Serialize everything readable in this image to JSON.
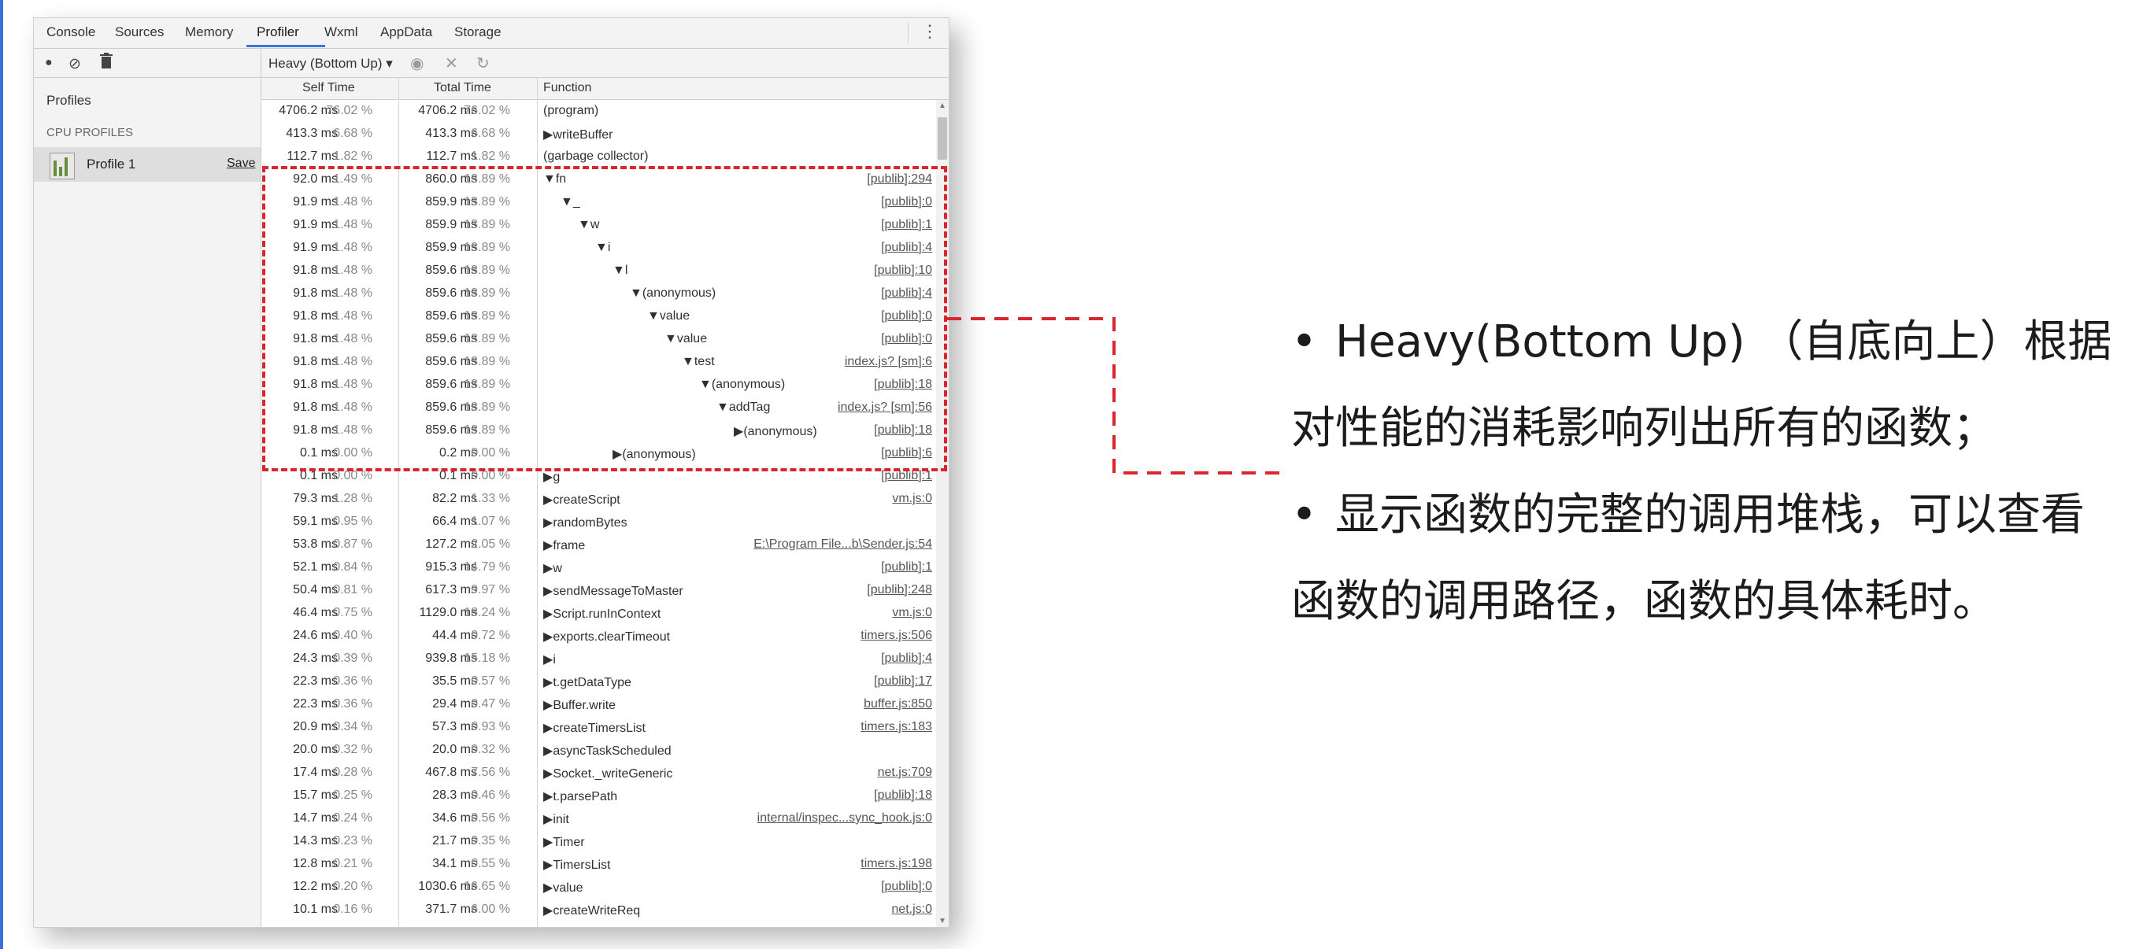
{
  "window": {
    "tabs": [
      "Console",
      "Sources",
      "Memory",
      "Profiler",
      "Wxml",
      "AppData",
      "Storage"
    ],
    "active_tab": "Profiler"
  },
  "toolbar": {
    "view_select": "Heavy (Bottom Up)"
  },
  "sidebar": {
    "title": "Profiles",
    "section_header": "CPU PROFILES",
    "profile_name": "Profile 1",
    "save_label": "Save"
  },
  "grid": {
    "columns": [
      "Self Time",
      "Total Time",
      "Function"
    ],
    "rows": [
      {
        "self_ms": "4706.2 ms",
        "self_pct": "76.02 %",
        "total_ms": "4706.2 ms",
        "total_pct": "76.02 %",
        "arrow": "",
        "depth": 0,
        "fn": "(program)",
        "url": ""
      },
      {
        "self_ms": "413.3 ms",
        "self_pct": "6.68 %",
        "total_ms": "413.3 ms",
        "total_pct": "6.68 %",
        "arrow": "▶",
        "depth": 0,
        "fn": "writeBuffer",
        "url": ""
      },
      {
        "self_ms": "112.7 ms",
        "self_pct": "1.82 %",
        "total_ms": "112.7 ms",
        "total_pct": "1.82 %",
        "arrow": "",
        "depth": 0,
        "fn": "(garbage collector)",
        "url": ""
      },
      {
        "self_ms": "92.0 ms",
        "self_pct": "1.49 %",
        "total_ms": "860.0 ms",
        "total_pct": "13.89 %",
        "arrow": "▼",
        "depth": 0,
        "fn": "fn",
        "url": "[publib]:294"
      },
      {
        "self_ms": "91.9 ms",
        "self_pct": "1.48 %",
        "total_ms": "859.9 ms",
        "total_pct": "13.89 %",
        "arrow": "▼",
        "depth": 1,
        "fn": "_",
        "url": "[publib]:0"
      },
      {
        "self_ms": "91.9 ms",
        "self_pct": "1.48 %",
        "total_ms": "859.9 ms",
        "total_pct": "13.89 %",
        "arrow": "▼",
        "depth": 2,
        "fn": "w",
        "url": "[publib]:1"
      },
      {
        "self_ms": "91.9 ms",
        "self_pct": "1.48 %",
        "total_ms": "859.9 ms",
        "total_pct": "13.89 %",
        "arrow": "▼",
        "depth": 3,
        "fn": "i",
        "url": "[publib]:4"
      },
      {
        "self_ms": "91.8 ms",
        "self_pct": "1.48 %",
        "total_ms": "859.6 ms",
        "total_pct": "13.89 %",
        "arrow": "▼",
        "depth": 4,
        "fn": "l",
        "url": "[publib]:10"
      },
      {
        "self_ms": "91.8 ms",
        "self_pct": "1.48 %",
        "total_ms": "859.6 ms",
        "total_pct": "13.89 %",
        "arrow": "▼",
        "depth": 5,
        "fn": "(anonymous)",
        "url": "[publib]:4"
      },
      {
        "self_ms": "91.8 ms",
        "self_pct": "1.48 %",
        "total_ms": "859.6 ms",
        "total_pct": "13.89 %",
        "arrow": "▼",
        "depth": 6,
        "fn": "value",
        "url": "[publib]:0"
      },
      {
        "self_ms": "91.8 ms",
        "self_pct": "1.48 %",
        "total_ms": "859.6 ms",
        "total_pct": "13.89 %",
        "arrow": "▼",
        "depth": 7,
        "fn": "value",
        "url": "[publib]:0"
      },
      {
        "self_ms": "91.8 ms",
        "self_pct": "1.48 %",
        "total_ms": "859.6 ms",
        "total_pct": "13.89 %",
        "arrow": "▼",
        "depth": 8,
        "fn": "test",
        "url": "index.js? [sm]:6"
      },
      {
        "self_ms": "91.8 ms",
        "self_pct": "1.48 %",
        "total_ms": "859.6 ms",
        "total_pct": "13.89 %",
        "arrow": "▼",
        "depth": 9,
        "fn": "(anonymous)",
        "url": "[publib]:18"
      },
      {
        "self_ms": "91.8 ms",
        "self_pct": "1.48 %",
        "total_ms": "859.6 ms",
        "total_pct": "13.89 %",
        "arrow": "▼",
        "depth": 10,
        "fn": "addTag",
        "url": "index.js? [sm]:56"
      },
      {
        "self_ms": "91.8 ms",
        "self_pct": "1.48 %",
        "total_ms": "859.6 ms",
        "total_pct": "13.89 %",
        "arrow": "▶",
        "depth": 11,
        "fn": "(anonymous)",
        "url": "[publib]:18"
      },
      {
        "self_ms": "0.1 ms",
        "self_pct": "0.00 %",
        "total_ms": "0.2 ms",
        "total_pct": "0.00 %",
        "arrow": "▶",
        "depth": 4,
        "fn": "(anonymous)",
        "url": "[publib]:6"
      },
      {
        "self_ms": "0.1 ms",
        "self_pct": "0.00 %",
        "total_ms": "0.1 ms",
        "total_pct": "0.00 %",
        "arrow": "▶",
        "depth": 0,
        "fn": "g",
        "url": "[publib]:1"
      },
      {
        "self_ms": "79.3 ms",
        "self_pct": "1.28 %",
        "total_ms": "82.2 ms",
        "total_pct": "1.33 %",
        "arrow": "▶",
        "depth": 0,
        "fn": "createScript",
        "url": "vm.js:0"
      },
      {
        "self_ms": "59.1 ms",
        "self_pct": "0.95 %",
        "total_ms": "66.4 ms",
        "total_pct": "1.07 %",
        "arrow": "▶",
        "depth": 0,
        "fn": "randomBytes",
        "url": ""
      },
      {
        "self_ms": "53.8 ms",
        "self_pct": "0.87 %",
        "total_ms": "127.2 ms",
        "total_pct": "2.05 %",
        "arrow": "▶",
        "depth": 0,
        "fn": "frame",
        "url": "E:\\Program File...b\\Sender.js:54"
      },
      {
        "self_ms": "52.1 ms",
        "self_pct": "0.84 %",
        "total_ms": "915.3 ms",
        "total_pct": "14.79 %",
        "arrow": "▶",
        "depth": 0,
        "fn": "w",
        "url": "[publib]:1"
      },
      {
        "self_ms": "50.4 ms",
        "self_pct": "0.81 %",
        "total_ms": "617.3 ms",
        "total_pct": "9.97 %",
        "arrow": "▶",
        "depth": 0,
        "fn": "sendMessageToMaster",
        "url": "[publib]:248"
      },
      {
        "self_ms": "46.4 ms",
        "self_pct": "0.75 %",
        "total_ms": "1129.0 ms",
        "total_pct": "18.24 %",
        "arrow": "▶",
        "depth": 0,
        "fn": "Script.runInContext",
        "url": "vm.js:0"
      },
      {
        "self_ms": "24.6 ms",
        "self_pct": "0.40 %",
        "total_ms": "44.4 ms",
        "total_pct": "0.72 %",
        "arrow": "▶",
        "depth": 0,
        "fn": "exports.clearTimeout",
        "url": "timers.js:506"
      },
      {
        "self_ms": "24.3 ms",
        "self_pct": "0.39 %",
        "total_ms": "939.8 ms",
        "total_pct": "15.18 %",
        "arrow": "▶",
        "depth": 0,
        "fn": "i",
        "url": "[publib]:4"
      },
      {
        "self_ms": "22.3 ms",
        "self_pct": "0.36 %",
        "total_ms": "35.5 ms",
        "total_pct": "0.57 %",
        "arrow": "▶",
        "depth": 0,
        "fn": "t.getDataType",
        "url": "[publib]:17"
      },
      {
        "self_ms": "22.3 ms",
        "self_pct": "0.36 %",
        "total_ms": "29.4 ms",
        "total_pct": "0.47 %",
        "arrow": "▶",
        "depth": 0,
        "fn": "Buffer.write",
        "url": "buffer.js:850"
      },
      {
        "self_ms": "20.9 ms",
        "self_pct": "0.34 %",
        "total_ms": "57.3 ms",
        "total_pct": "0.93 %",
        "arrow": "▶",
        "depth": 0,
        "fn": "createTimersList",
        "url": "timers.js:183"
      },
      {
        "self_ms": "20.0 ms",
        "self_pct": "0.32 %",
        "total_ms": "20.0 ms",
        "total_pct": "0.32 %",
        "arrow": "▶",
        "depth": 0,
        "fn": "asyncTaskScheduled",
        "url": ""
      },
      {
        "self_ms": "17.4 ms",
        "self_pct": "0.28 %",
        "total_ms": "467.8 ms",
        "total_pct": "7.56 %",
        "arrow": "▶",
        "depth": 0,
        "fn": "Socket._writeGeneric",
        "url": "net.js:709"
      },
      {
        "self_ms": "15.7 ms",
        "self_pct": "0.25 %",
        "total_ms": "28.3 ms",
        "total_pct": "0.46 %",
        "arrow": "▶",
        "depth": 0,
        "fn": "t.parsePath",
        "url": "[publib]:18"
      },
      {
        "self_ms": "14.7 ms",
        "self_pct": "0.24 %",
        "total_ms": "34.6 ms",
        "total_pct": "0.56 %",
        "arrow": "▶",
        "depth": 0,
        "fn": "init",
        "url": "internal/inspec...sync_hook.js:0"
      },
      {
        "self_ms": "14.3 ms",
        "self_pct": "0.23 %",
        "total_ms": "21.7 ms",
        "total_pct": "0.35 %",
        "arrow": "▶",
        "depth": 0,
        "fn": "Timer",
        "url": ""
      },
      {
        "self_ms": "12.8 ms",
        "self_pct": "0.21 %",
        "total_ms": "34.1 ms",
        "total_pct": "0.55 %",
        "arrow": "▶",
        "depth": 0,
        "fn": "TimersList",
        "url": "timers.js:198"
      },
      {
        "self_ms": "12.2 ms",
        "self_pct": "0.20 %",
        "total_ms": "1030.6 ms",
        "total_pct": "16.65 %",
        "arrow": "▶",
        "depth": 0,
        "fn": "value",
        "url": "[publib]:0"
      },
      {
        "self_ms": "10.1 ms",
        "self_pct": "0.16 %",
        "total_ms": "371.7 ms",
        "total_pct": "6.00 %",
        "arrow": "▶",
        "depth": 0,
        "fn": "createWriteReq",
        "url": "net.js:0"
      }
    ]
  },
  "annotation": {
    "color": "#d9262c",
    "notes": [
      "Heavy(Bottom Up) （自底向上）根据对性能的消耗影响列出所有的函数；",
      "显示函数的完整的调用堆栈，可以查看函数的调用路径，函数的具体耗时。"
    ]
  }
}
